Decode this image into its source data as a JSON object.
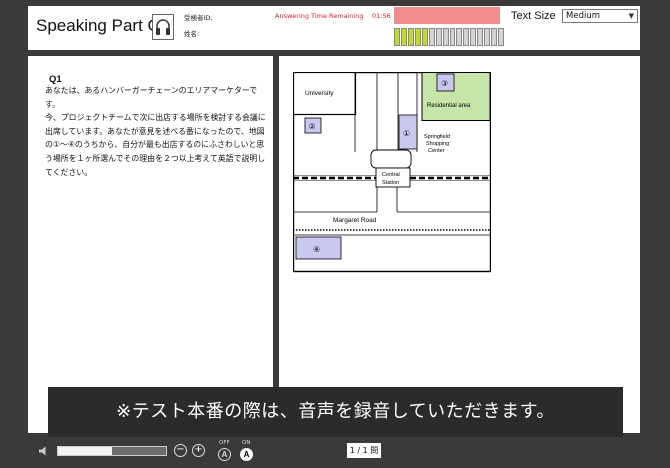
{
  "header": {
    "title": "Speaking Part C",
    "examinee_id_label": "受検者ID:",
    "name_label": "姓名:",
    "timer_label": "Answering Time Remaining",
    "timer_value": "01:56",
    "timer_fill_fraction": 1.0,
    "level_meter": {
      "segments": 16,
      "active": 5
    },
    "text_size_label": "Text Size",
    "text_size_value": "Medium",
    "headphone_icon": "headphones-icon"
  },
  "question": {
    "number": "Q1",
    "text": "あなたは、あるハンバーガーチェーンのエリアマーケターです。\n今、プロジェクトチームで次に出店する場所を検討する会議に出席しています。あなたが意見を述べる番になったので、地図の①〜④のうちから、自分が最も出店するのにふさわしいと思う場所を１ヶ所選んでその理由を２つ以上考えて英語で説明してください。"
  },
  "map": {
    "university": "University",
    "residential": "Residential area",
    "springfield": [
      "Springfield",
      "Shopping",
      "Center"
    ],
    "station": [
      "Central",
      "Station"
    ],
    "road": "Margaret Road",
    "markers": [
      "①",
      "②",
      "③",
      "④"
    ],
    "colors": {
      "residential": "#c6e5a8",
      "candidate": "#c9c9ef"
    }
  },
  "overlay": {
    "text": "※テスト本番の際は、音声を録音していただきます。"
  },
  "footer": {
    "volume_fraction": 0.5,
    "minus": "−",
    "plus": "+",
    "off_label": "OFF",
    "on_label": "ON",
    "toggle_glyph": "A",
    "page": "1 / 1 問"
  }
}
